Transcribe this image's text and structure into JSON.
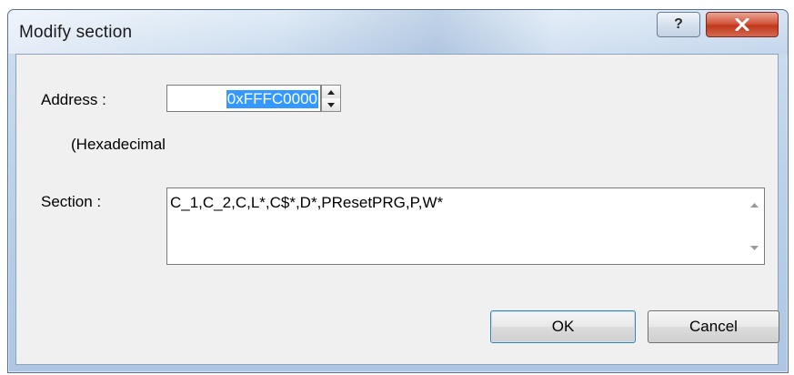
{
  "window": {
    "title": "Modify section",
    "help_label": "?",
    "close_label": "x"
  },
  "address": {
    "label": "Address :",
    "value": "0xFFFC0000",
    "hint": "(Hexadecimal"
  },
  "section": {
    "label": "Section :",
    "value": "C_1,C_2,C,L*,C$*,D*,PResetPRG,P,W*"
  },
  "buttons": {
    "ok_label": "OK",
    "cancel_label": "Cancel"
  },
  "icons": {
    "spin_up": "triangle-up-icon",
    "spin_down": "triangle-down-icon",
    "scroll_up": "scroll-up-icon",
    "scroll_down": "scroll-down-icon"
  },
  "colors": {
    "selection": "#3399ff",
    "close_button": "#c8452b",
    "dialog_bg": "#f0f0f0"
  }
}
